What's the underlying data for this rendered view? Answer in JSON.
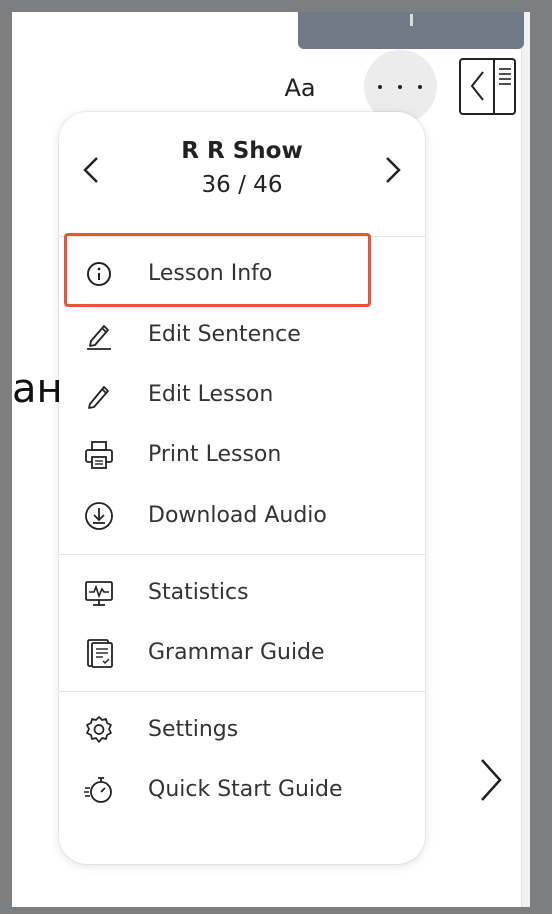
{
  "toolbar": {
    "font_label": "Aa",
    "more_icon": "ellipsis-icon",
    "sidebar_icon": "sidebar-toggle-icon"
  },
  "background": {
    "cut_text": "ана"
  },
  "menu": {
    "title": "R R Show",
    "progress": "36 / 46",
    "items": [
      {
        "label": "Lesson Info",
        "icon": "info-icon"
      },
      {
        "label": "Edit Sentence",
        "icon": "edit-sentence-icon"
      },
      {
        "label": "Edit Lesson",
        "icon": "pencil-icon"
      },
      {
        "label": "Print Lesson",
        "icon": "printer-icon"
      },
      {
        "label": "Download Audio",
        "icon": "download-icon"
      },
      {
        "label": "Statistics",
        "icon": "statistics-icon"
      },
      {
        "label": "Grammar Guide",
        "icon": "grammar-guide-icon"
      },
      {
        "label": "Settings",
        "icon": "gear-icon"
      },
      {
        "label": "Quick Start Guide",
        "icon": "stopwatch-icon"
      }
    ]
  },
  "colors": {
    "highlight": "#e8533a",
    "frame": "#7d7e80",
    "top_tab": "#707a86"
  }
}
